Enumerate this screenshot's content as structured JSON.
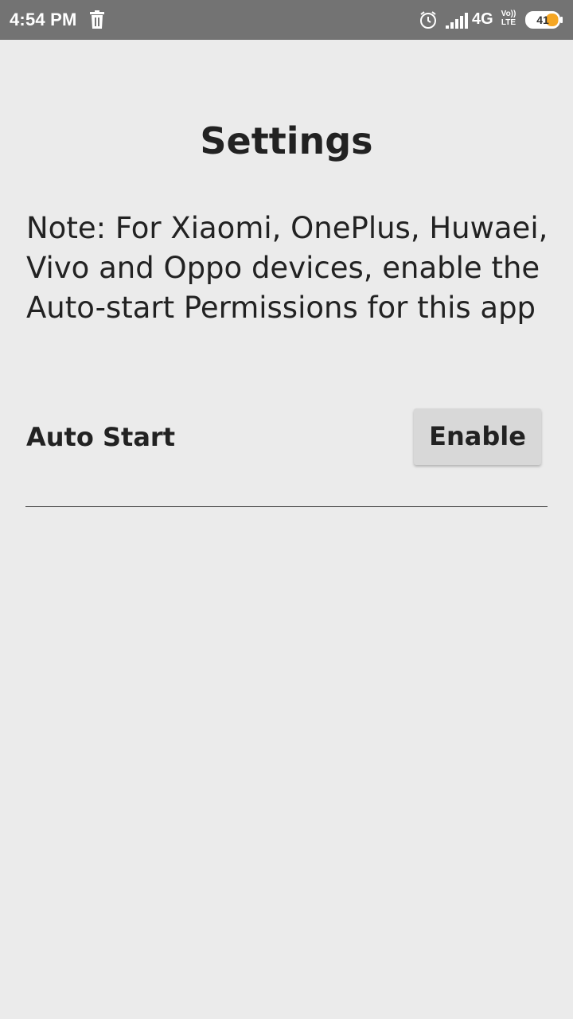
{
  "status_bar": {
    "time": "4:54 PM",
    "network": "4G",
    "volte_top": "Vo))",
    "volte_bottom": "LTE",
    "battery_level": "41",
    "battery_fraction": 0.41,
    "battery_fill_color": "#f5a623",
    "background_color": "#737373",
    "icons": [
      "trash-icon",
      "alarm-icon",
      "signal-icon",
      "battery-icon"
    ]
  },
  "page": {
    "title": "Settings",
    "note": "Note: For Xiaomi, OnePlus, Huwaei, Vivo and Oppo devices, enable the Auto-start Permissions for this app",
    "background_color": "#ebebeb"
  },
  "auto_start": {
    "label": "Auto Start",
    "button_label": "Enable"
  }
}
